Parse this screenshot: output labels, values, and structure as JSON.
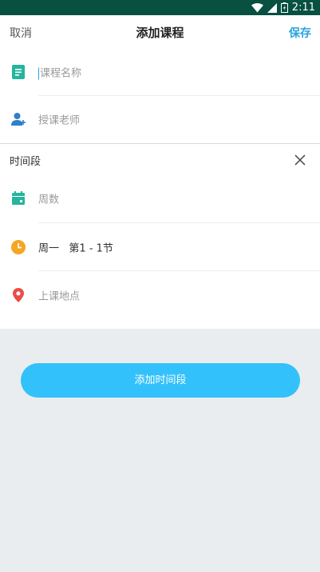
{
  "status_bar": {
    "time": "2:11"
  },
  "header": {
    "cancel_label": "取消",
    "title": "添加课程",
    "save_label": "保存"
  },
  "course": {
    "name_placeholder": "课程名称",
    "teacher_placeholder": "授课老师"
  },
  "time_section": {
    "label": "时间段",
    "weeks_placeholder": "周数",
    "day_value": "周一",
    "period_value": "第1 - 1节",
    "location_placeholder": "上课地点"
  },
  "add_button_label": "添加时间段",
  "colors": {
    "status_bar": "#075042",
    "accent": "#2aa3de",
    "button": "#33c1fb",
    "name_icon": "#26b59c",
    "teacher_icon": "#2f7fc9",
    "weeks_icon": "#26b59c",
    "time_icon": "#f5a623",
    "location_icon": "#ec4c47"
  },
  "icons": {
    "name": "document-icon",
    "teacher": "person-add-icon",
    "weeks": "calendar-icon",
    "time": "clock-icon",
    "location": "location-pin-icon",
    "close": "close-icon"
  }
}
